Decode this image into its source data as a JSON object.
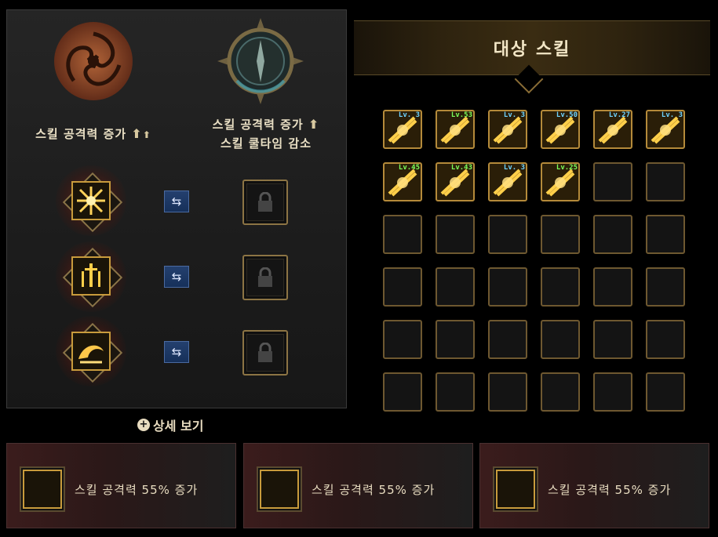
{
  "left_panel": {
    "pole_left": {
      "line1": "스킬 공격력 증가"
    },
    "pole_right": {
      "line1": "스킬 공격력 증가",
      "line2": "스킬 쿨타임 감소"
    },
    "swap_icon": "⇆",
    "slots": [
      {
        "icon": "radiant-burst-skill-icon"
      },
      {
        "icon": "sword-rain-skill-icon"
      },
      {
        "icon": "dragon-flame-skill-icon"
      }
    ],
    "detail_link": "상세 보기",
    "detail_icon": "+"
  },
  "target_panel": {
    "title": "대상 스킬",
    "skills": [
      {
        "level": "Lv. 3",
        "level_color": "#6fd3ff"
      },
      {
        "level": "Lv.53",
        "level_color": "#7cff5a"
      },
      {
        "level": "Lv. 3",
        "level_color": "#6fd3ff"
      },
      {
        "level": "Lv.50",
        "level_color": "#6fd3ff"
      },
      {
        "level": "Lv.27",
        "level_color": "#6fd3ff"
      },
      {
        "level": "Lv. 3",
        "level_color": "#6fd3ff"
      },
      {
        "level": "Lv.45",
        "level_color": "#7cff5a"
      },
      {
        "level": "Lv.43",
        "level_color": "#7cff5a"
      },
      {
        "level": "Lv. 3",
        "level_color": "#6fd3ff"
      },
      {
        "level": "Lv.25",
        "level_color": "#7cff5a"
      }
    ],
    "total_cells": 36
  },
  "effects": [
    {
      "text": "스킬 공격력 55% 증가"
    },
    {
      "text": "스킬 공격력 55% 증가"
    },
    {
      "text": "스킬 공격력 55% 증가"
    }
  ],
  "colors": {
    "gold_border": "#c89b3c",
    "level_blue": "#6fd3ff",
    "level_green": "#7cff5a",
    "swap_blue": "#24406e"
  }
}
